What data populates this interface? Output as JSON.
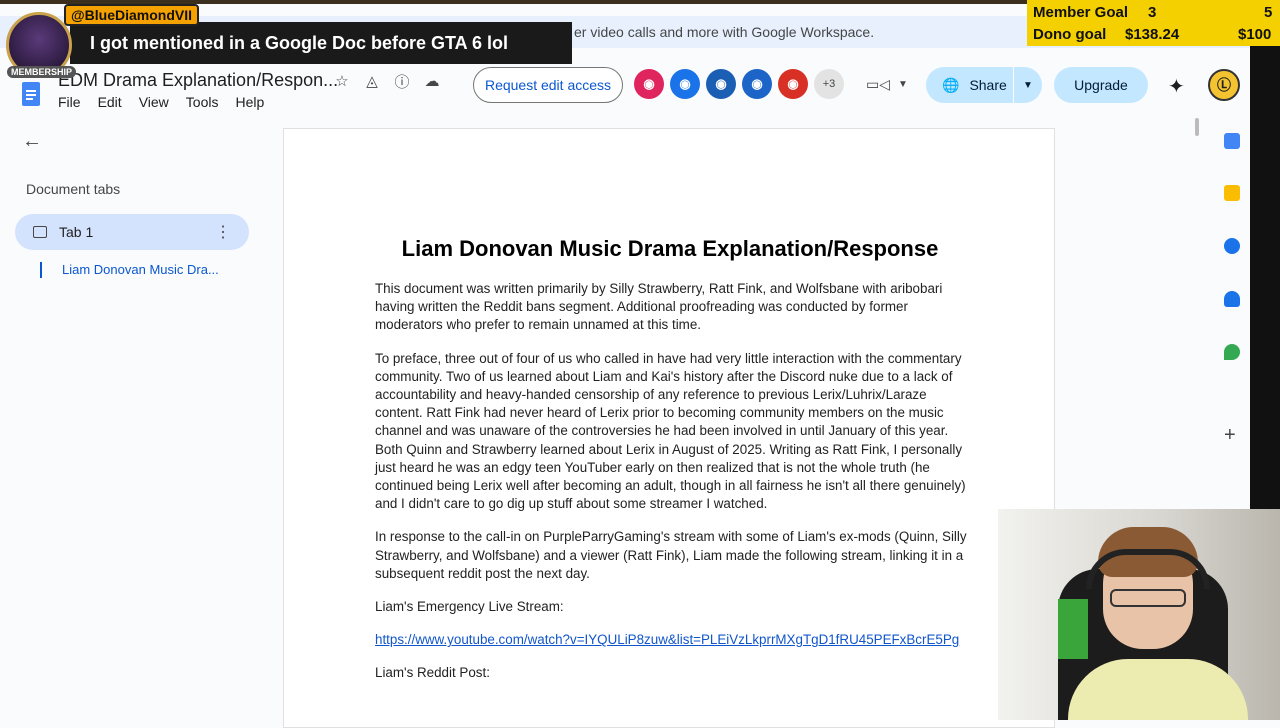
{
  "overlay": {
    "member_badge": "@BlueDiamondVII",
    "mention_text": "I got mentioned in a Google Doc before GTA 6 lol",
    "membership_tag": "MEMBERSHIP",
    "member_goal_label": "Member Goal",
    "member_goal_current": "3",
    "member_goal_target": "5",
    "dono_goal_label": "Dono goal",
    "dono_goal_current": "$138.24",
    "dono_goal_target": "$100"
  },
  "promo": {
    "text": "er video calls and more with Google Workspace."
  },
  "header": {
    "doc_title": "EDM Drama Explanation/Respon...",
    "menu": [
      "File",
      "Edit",
      "View",
      "Tools",
      "Help"
    ],
    "request_edit": "Request edit access",
    "more_collaborators": "+3",
    "share": "Share",
    "upgrade": "Upgrade",
    "account_initial": "Ⓛ"
  },
  "sidebar": {
    "heading": "Document tabs",
    "tab_label": "Tab 1",
    "outline_item": "Liam Donovan Music Dra..."
  },
  "document": {
    "title": "Liam Donovan Music Drama Explanation/Response",
    "para1": "This document was written primarily by Silly Strawberry, Ratt Fink, and Wolfsbane with aribobari having written the Reddit bans segment. Additional proofreading was conducted by former moderators who prefer to remain unnamed at this time.",
    "para2": "To preface, three out of four of us who called in have had very little interaction with the commentary community. Two of us learned about Liam and Kai's history after the Discord nuke due to a lack of accountability and heavy-handed censorship of any reference to previous Lerix/Luhrix/Laraze content. Ratt Fink had never heard of Lerix prior to becoming community members on the music channel and was unaware of the controversies he had been involved in until January of this year. Both Quinn and Strawberry learned about Lerix in August of 2025. Writing as Ratt Fink, I personally just heard he was an edgy teen YouTuber early on then realized that is not the whole truth (he continued being Lerix well after becoming an adult, though in all fairness he isn't all there genuinely) and I didn't care to go dig up stuff about some streamer I watched.",
    "para3": "In response to the call-in on PurpleParryGaming's stream with some of Liam's ex-mods (Quinn, Silly Strawberry, and Wolfsbane) and a viewer (Ratt Fink), Liam made the following stream, linking it in a subsequent reddit post the next day.",
    "para4": "Liam's Emergency Live Stream:",
    "link": "https://www.youtube.com/watch?v=IYQULiP8zuw&list=PLEiVzLkprrMXgTgD1fRU45PEFxBcrE5Pg",
    "para5": "Liam's Reddit Post:"
  },
  "colors": {
    "accent": "#0b57d0",
    "share_bg": "#c2e7ff",
    "goal_bg": "#f5d000"
  }
}
